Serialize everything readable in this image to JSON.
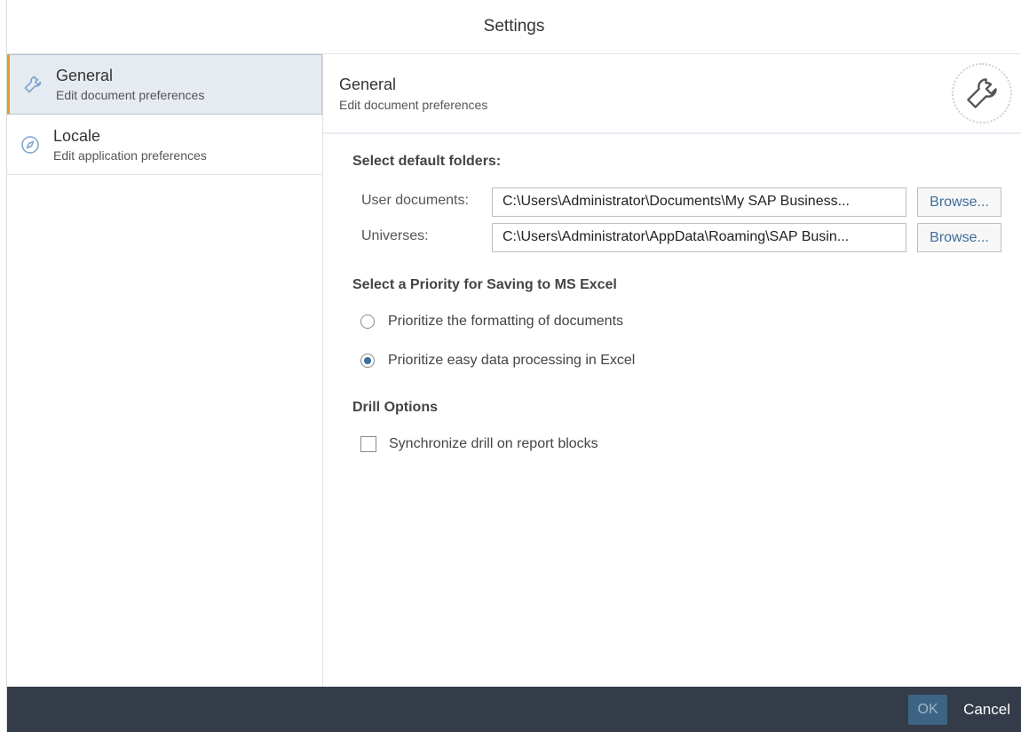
{
  "window": {
    "title": "Settings"
  },
  "sidebar": {
    "items": [
      {
        "title": "General",
        "subtitle": "Edit document preferences",
        "icon": "wrench-icon",
        "selected": true
      },
      {
        "title": "Locale",
        "subtitle": "Edit application preferences",
        "icon": "compass-icon",
        "selected": false
      }
    ]
  },
  "header": {
    "title": "General",
    "subtitle": "Edit document preferences",
    "icon": "wrench-icon"
  },
  "folders": {
    "heading": "Select default folders:",
    "user_documents_label": "User documents:",
    "user_documents_value": "C:\\Users\\Administrator\\Documents\\My SAP Business...",
    "universes_label": "Universes:",
    "universes_value": "C:\\Users\\Administrator\\AppData\\Roaming\\SAP Busin...",
    "browse_label": "Browse..."
  },
  "excel": {
    "heading": "Select a Priority for Saving to MS Excel",
    "option_formatting": "Prioritize the formatting of documents",
    "option_data": "Prioritize easy data processing in Excel",
    "selected": "option_data"
  },
  "drill": {
    "heading": "Drill Options",
    "sync_label": "Synchronize drill on report blocks",
    "sync_checked": false
  },
  "footer": {
    "ok_label": "OK",
    "cancel_label": "Cancel"
  },
  "colors": {
    "accent": "#e2a11f",
    "footer_bg": "#333c48",
    "ok_bg": "#3d6385",
    "selected_bg": "#e6ebf2"
  }
}
